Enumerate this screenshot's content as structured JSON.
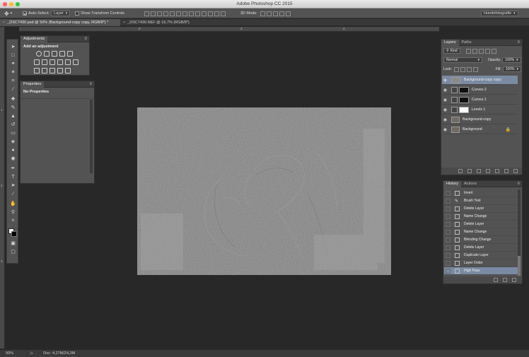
{
  "window": {
    "title": "Adobe Photoshop CC 2015"
  },
  "options_bar": {
    "auto_select_label": "Auto-Select:",
    "auto_select_value": "Layer",
    "show_transform_label": "Show Transform Controls",
    "mode_3d_label": "3D Mode:",
    "workspace_value": "Hundefotografie"
  },
  "tabs": [
    {
      "label": "_DSC7430.psd @ 50% (Background-copy copy, RGB/8*) *"
    },
    {
      "label": "_DSC7430.NEF @ 16,7% (RGB/8*)"
    }
  ],
  "ruler": {
    "top_ticks": [
      "0",
      "2",
      "4"
    ],
    "left_ticks": [
      "1",
      "2",
      "3"
    ]
  },
  "adjustments": {
    "tab_label": "Adjustments",
    "heading": "Add an adjustment"
  },
  "properties": {
    "tab_label": "Properties",
    "empty_text": "No Properties"
  },
  "layers_panel": {
    "tab_layers": "Layers",
    "tab_paths": "Paths",
    "filter_value": "Kind",
    "blend_mode": "Normal",
    "opacity_label": "Opacity:",
    "opacity_value": "100%",
    "lock_label": "Lock:",
    "fill_label": "Fill:",
    "fill_value": "100%",
    "layers": [
      {
        "name": "Background-copy copy"
      },
      {
        "name": "Curves 2"
      },
      {
        "name": "Curves 1"
      },
      {
        "name": "Levels 1"
      },
      {
        "name": "Background-copy"
      },
      {
        "name": "Background"
      }
    ]
  },
  "history_panel": {
    "tab_history": "History",
    "tab_actions": "Actions",
    "steps": [
      {
        "name": "Invert"
      },
      {
        "name": "Brush Tool"
      },
      {
        "name": "Delete Layer"
      },
      {
        "name": "Name Change"
      },
      {
        "name": "Delete Layer"
      },
      {
        "name": "Name Change"
      },
      {
        "name": "Blending Change"
      },
      {
        "name": "Delete Layer"
      },
      {
        "name": "Duplicate Layer"
      },
      {
        "name": "Layer Order"
      },
      {
        "name": "High Pass"
      }
    ]
  },
  "status_bar": {
    "zoom": "50%",
    "doc_info": "Doc: 4,27M/24,3M"
  },
  "colors": {
    "selection": "#7a8aa3",
    "panel": "#535353",
    "background": "#282828"
  }
}
